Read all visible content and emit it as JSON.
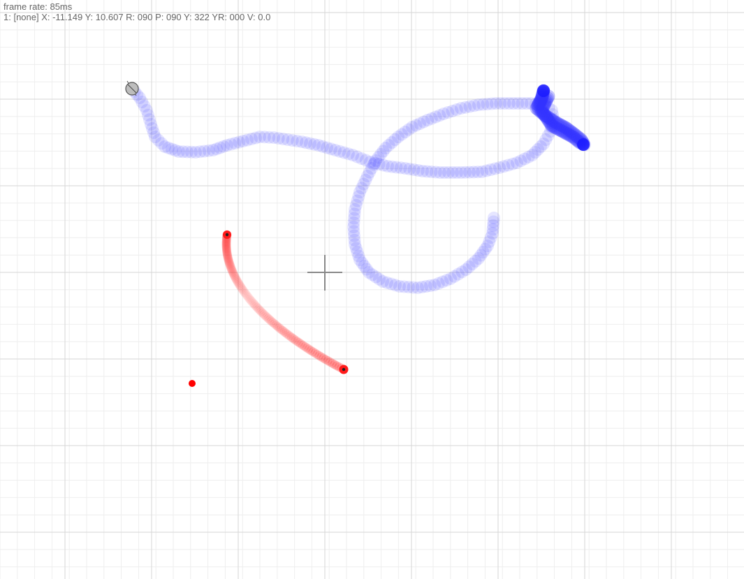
{
  "hud": {
    "frame_rate": "frame rate: 85ms",
    "pointer_status": "1: [none] X: -11.149 Y: 10.607 R: 090 P: 090 Y: 322 YR: 000 V: 0.0"
  },
  "colors": {
    "background": "#ffffff",
    "grid_minor": "#eeeeee",
    "grid_major": "#d6d6d6",
    "crosshair": "#888888",
    "blue_trail": "#3333ff",
    "red_trail": "#ff1a1a",
    "pen_tip": "#bdbdbd",
    "text": "#666666"
  }
}
